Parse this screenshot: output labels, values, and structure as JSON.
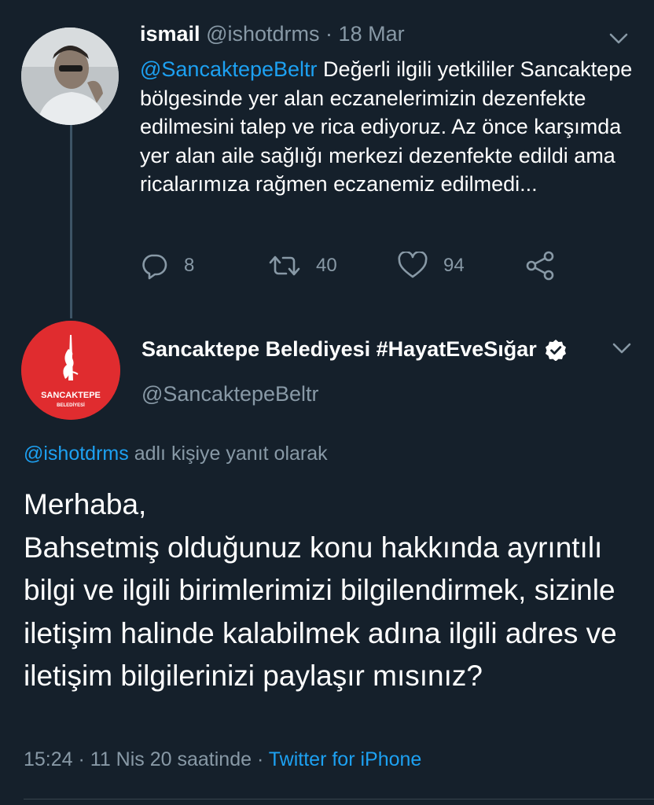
{
  "tweet1": {
    "display_name": "ismail",
    "handle": "@ishotdrms",
    "separator": "·",
    "date": "18 Mar",
    "mention": "@SancaktepeBeltr",
    "text": " Değerli ilgili yetkililer Sancaktepe bölgesinde yer alan eczanelerimizin dezenfekte edilmesini talep ve rica ediyoruz. Az önce karşımda yer alan aile sağlığı merkezi dezenfekte edildi ama ricalarımıza rağmen eczanemiz edilmedi...",
    "reply_count": "8",
    "retweet_count": "40",
    "like_count": "94"
  },
  "tweet2": {
    "display_name": "Sancaktepe Belediyesi #HayatEveSığar",
    "handle": "@SancaktepeBeltr",
    "reply_to_handle": "@ishotdrms",
    "reply_to_suffix": " adlı kişiye yanıt olarak",
    "text": "Merhaba,\nBahsetmiş olduğunuz konu hakkında ayrıntılı bilgi ve ilgili birimlerimizi bilgilendirmek, sizinle iletişim halinde kalabilmek adına ilgili adres ve iletişim bilgilerinizi paylaşır mısınız?",
    "time": "15:24",
    "sep1": " · ",
    "date": "11 Nis 20 saatinde",
    "sep2": " · ",
    "source": "Twitter for iPhone",
    "logo_text_line1": "SANCAKTEPE",
    "logo_text_line2": "BELEDİYESİ"
  },
  "icons": {
    "reply": "reply-icon",
    "retweet": "retweet-icon",
    "like": "heart-icon",
    "share": "share-icon",
    "more": "chevron-down-icon",
    "verified": "verified-badge-icon"
  },
  "colors": {
    "background": "#15202b",
    "accent": "#1da1f2",
    "muted": "#8899a6",
    "brand_red": "#e02c2f"
  }
}
